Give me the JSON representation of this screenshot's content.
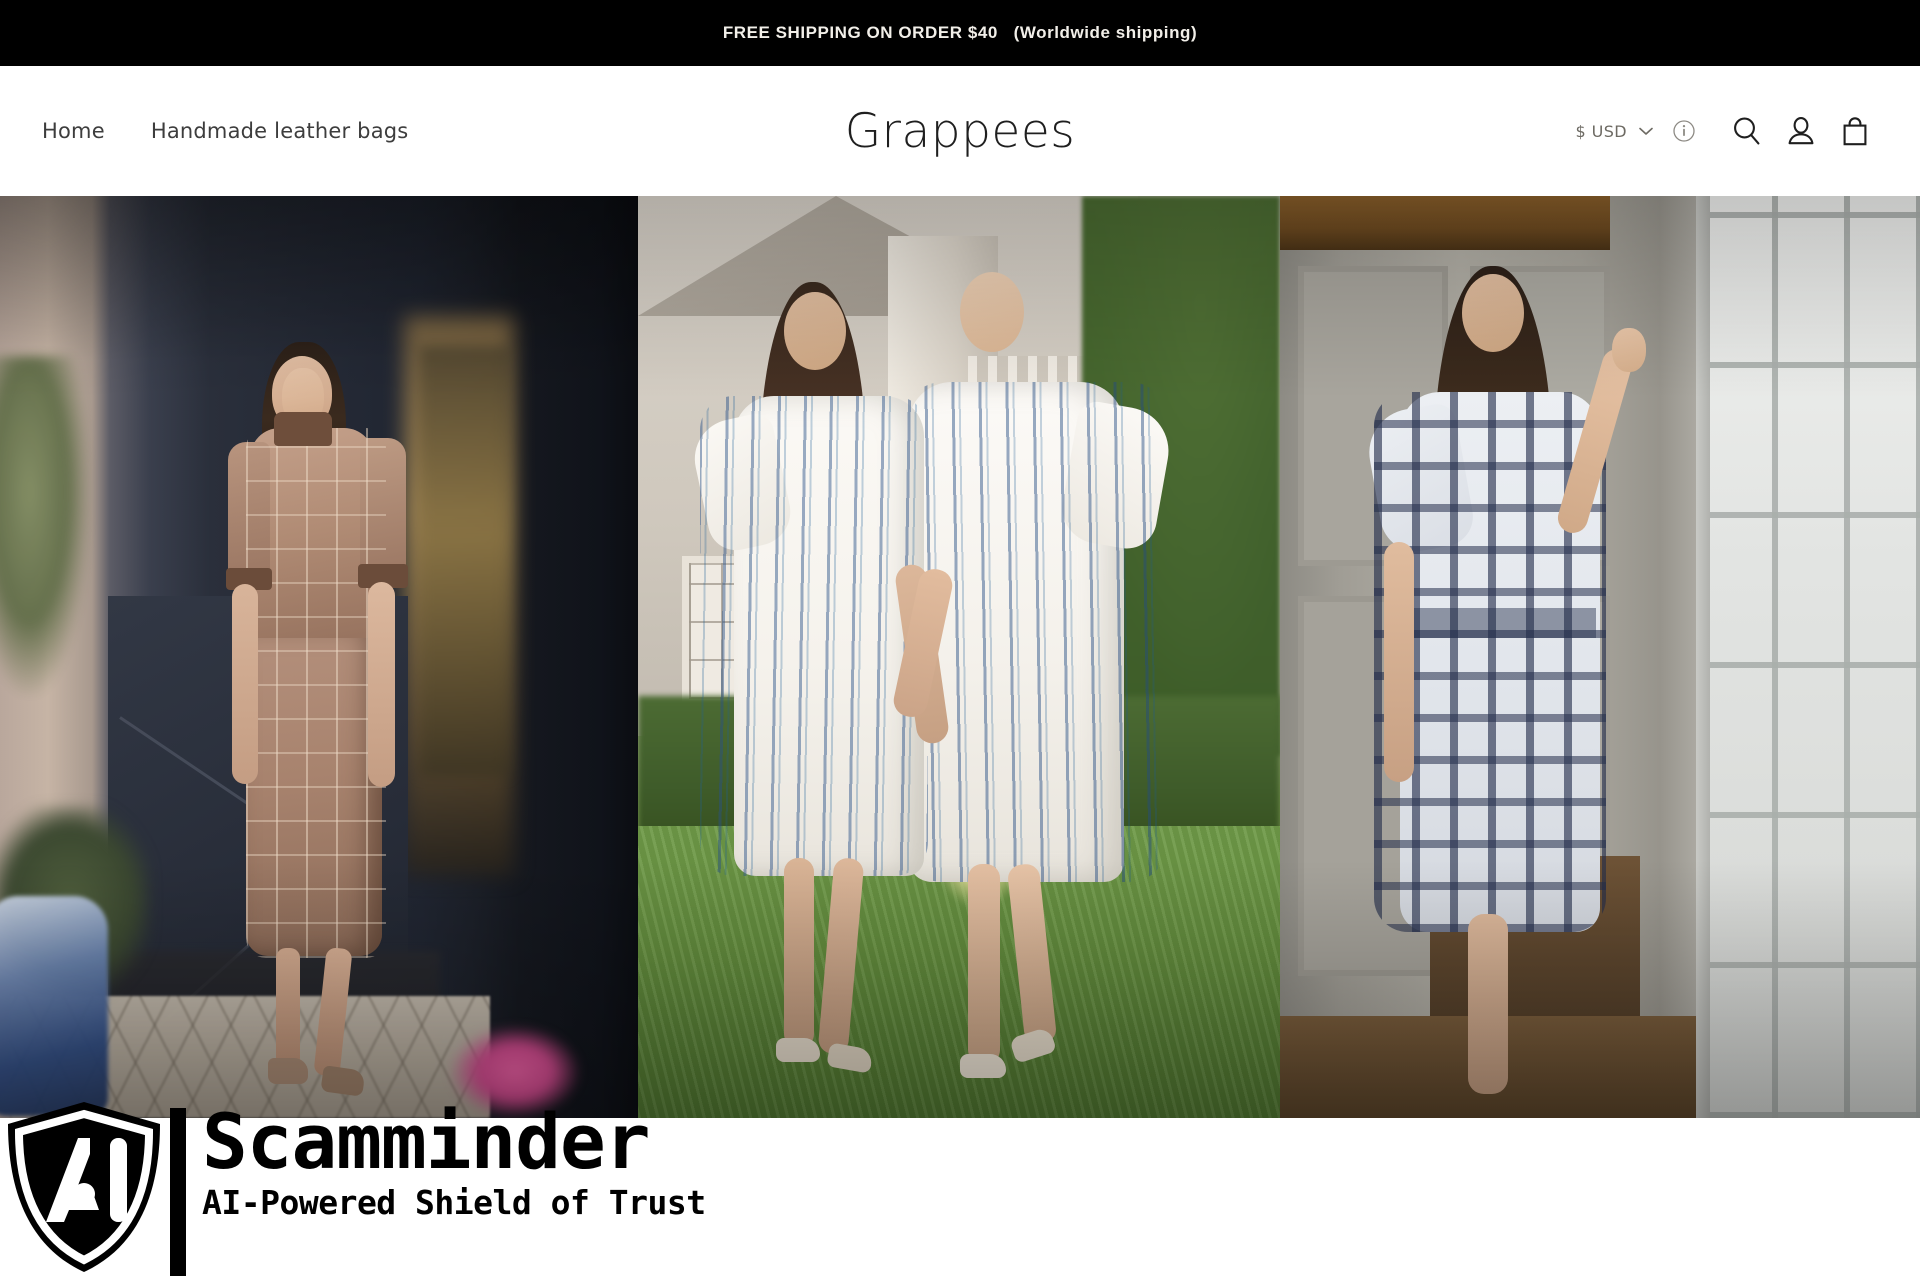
{
  "announcement": {
    "text": "FREE SHIPPING ON ORDER $40   (Worldwide shipping)",
    "background_color": "#000000",
    "text_color": "#f2efe9"
  },
  "header": {
    "brand": "Grappees",
    "nav": [
      {
        "label": "Home",
        "name": "nav-home"
      },
      {
        "label": "Handmade leather bags",
        "name": "nav-handmade-leather-bags"
      }
    ],
    "currency": {
      "label": "$ USD",
      "chevron_icon": "chevron-down-icon",
      "info_icon": "info-circle-icon"
    },
    "actions": [
      {
        "name": "search-icon",
        "label": "Search"
      },
      {
        "name": "account-icon",
        "label": "Account"
      },
      {
        "name": "cart-icon",
        "label": "Cart"
      }
    ]
  },
  "hero": {
    "panels": [
      {
        "name": "hero-panel-1",
        "alt": "Woman in brown plaid midi dress standing in a dark navy doorway",
        "dominant_colors": [
          "#b08b74",
          "#2a2f3b",
          "#c6b4a5"
        ]
      },
      {
        "name": "hero-panel-2",
        "alt": "Two women walking on a lawn wearing white dresses with blue floral stripes",
        "dominant_colors": [
          "#fbf9f5",
          "#2a5a8c",
          "#66913f"
        ]
      },
      {
        "name": "hero-panel-3",
        "alt": "Woman in navy and white plaid dress beside a window in a grey panelled room",
        "dominant_colors": [
          "#e2e6ec",
          "#222c4a",
          "#a9a69e"
        ]
      }
    ]
  },
  "watermark": {
    "logo_icon": "ai-shield-icon",
    "logo_letters": "AI",
    "title": "Scamminder",
    "tagline": "AI-Powered Shield of Trust",
    "color": "#000000"
  }
}
